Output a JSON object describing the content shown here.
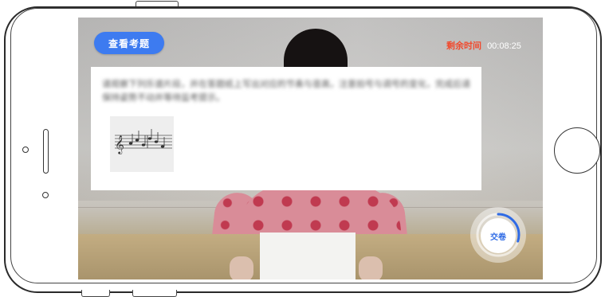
{
  "header": {
    "view_question_label": "查看考题",
    "timer_label": "剩余时间",
    "timer_value": "00:08:25"
  },
  "question": {
    "text": "请观察下列乐谱片段，并在答题纸上写出对应的节奏与音高，注意拍号与调号的变化，完成后请保持姿势不动并等待监考提示。"
  },
  "footer": {
    "submit_label": "交卷"
  },
  "colors": {
    "accent_blue": "#3d7bf0",
    "timer_red": "#f04a2e",
    "progress_blue": "#2f6be5"
  },
  "progress": {
    "remaining_fraction": 0.3
  }
}
